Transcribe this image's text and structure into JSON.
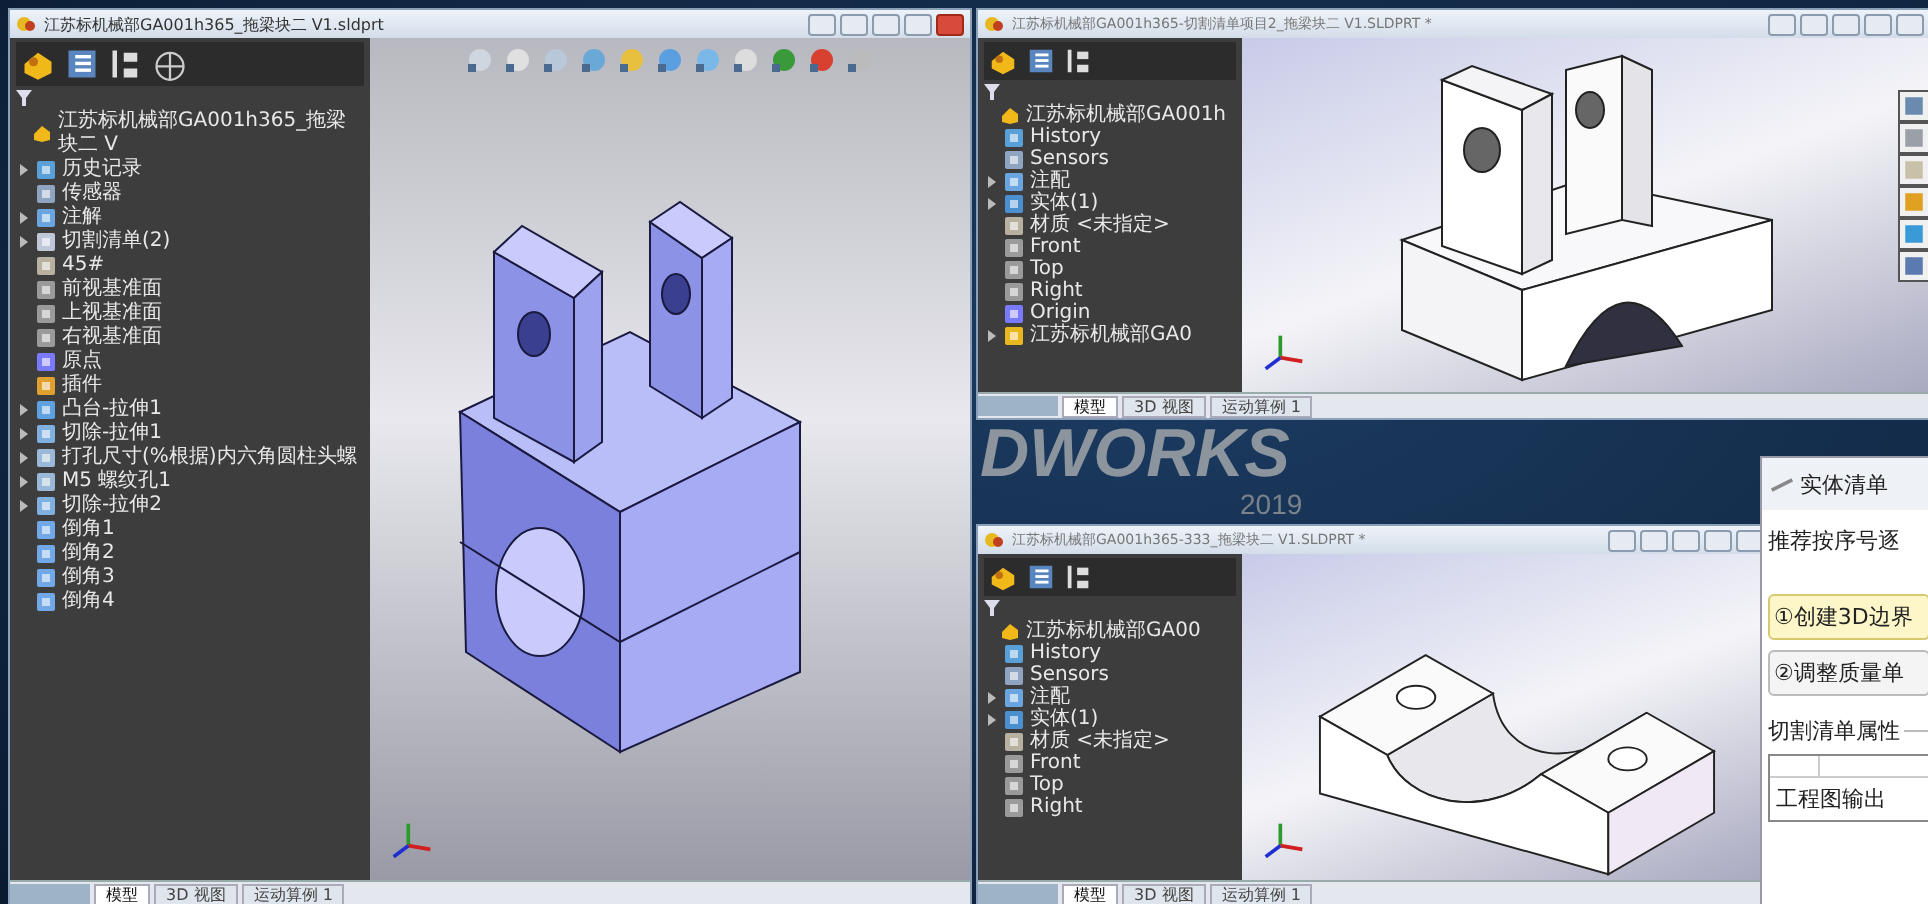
{
  "main_window": {
    "title": "江苏标机械部GA001h365_拖梁块二 V1.sldprt",
    "tree_root": "江苏标机械部GA001h365_拖梁块二 V",
    "tree": [
      {
        "label": "历史记录",
        "kind": "history",
        "expandable": true
      },
      {
        "label": "传感器",
        "kind": "sensor",
        "expandable": false
      },
      {
        "label": "注解",
        "kind": "annotation",
        "expandable": true
      },
      {
        "label": "切割清单(2)",
        "kind": "cutlist",
        "expandable": true
      },
      {
        "label": "45#",
        "kind": "material",
        "expandable": false
      },
      {
        "label": "前视基准面",
        "kind": "plane",
        "expandable": false
      },
      {
        "label": "上视基准面",
        "kind": "plane",
        "expandable": false
      },
      {
        "label": "右视基准面",
        "kind": "plane",
        "expandable": false
      },
      {
        "label": "原点",
        "kind": "origin",
        "expandable": false
      },
      {
        "label": "插件",
        "kind": "plugin",
        "expandable": false
      },
      {
        "label": "凸台-拉伸1",
        "kind": "extrude",
        "expandable": true
      },
      {
        "label": "切除-拉伸1",
        "kind": "cut",
        "expandable": true
      },
      {
        "label": "打孔尺寸(%根据)内六角圆柱头螺",
        "kind": "hole",
        "expandable": true
      },
      {
        "label": "M5 螺纹孔1",
        "kind": "hole",
        "expandable": true
      },
      {
        "label": "切除-拉伸2",
        "kind": "cut",
        "expandable": true
      },
      {
        "label": "倒角1",
        "kind": "chamfer",
        "expandable": false
      },
      {
        "label": "倒角2",
        "kind": "chamfer",
        "expandable": false
      },
      {
        "label": "倒角3",
        "kind": "chamfer",
        "expandable": false
      },
      {
        "label": "倒角4",
        "kind": "chamfer",
        "expandable": false
      }
    ],
    "tabs": [
      {
        "label": "模型",
        "selected": true
      },
      {
        "label": "3D 视图",
        "selected": false
      },
      {
        "label": "运动算例 1",
        "selected": false
      }
    ]
  },
  "top_right_window": {
    "title": "江苏标机械部GA001h365-切割清单项目2_拖梁块二 V1.SLDPRT *",
    "tree_root": "江苏标机械部GA001h",
    "tree": [
      {
        "label": "History",
        "kind": "history",
        "expandable": false
      },
      {
        "label": "Sensors",
        "kind": "sensor",
        "expandable": false
      },
      {
        "label": "注配",
        "kind": "annotation",
        "expandable": true
      },
      {
        "label": "实体(1)",
        "kind": "body",
        "expandable": true
      },
      {
        "label": "材质 <未指定>",
        "kind": "material",
        "expandable": false
      },
      {
        "label": "Front",
        "kind": "plane",
        "expandable": false
      },
      {
        "label": "Top",
        "kind": "plane",
        "expandable": false
      },
      {
        "label": "Right",
        "kind": "plane",
        "expandable": false
      },
      {
        "label": "Origin",
        "kind": "origin",
        "expandable": false
      },
      {
        "label": "江苏标机械部GA0",
        "kind": "part",
        "expandable": true
      }
    ],
    "tabs": [
      {
        "label": "模型",
        "selected": true
      },
      {
        "label": "3D 视图",
        "selected": false
      },
      {
        "label": "运动算例 1",
        "selected": false
      }
    ]
  },
  "splash": {
    "wordmark": "DWORKS",
    "year": "2019"
  },
  "bottom_right_window": {
    "title": "江苏标机械部GA001h365-333_拖梁块二 V1.SLDPRT *",
    "tree_root": "江苏标机械部GA00",
    "tree": [
      {
        "label": "History",
        "kind": "history",
        "expandable": false
      },
      {
        "label": "Sensors",
        "kind": "sensor",
        "expandable": false
      },
      {
        "label": "注配",
        "kind": "annotation",
        "expandable": true
      },
      {
        "label": "实体(1)",
        "kind": "body",
        "expandable": true
      },
      {
        "label": "材质 <未指定>",
        "kind": "material",
        "expandable": false
      },
      {
        "label": "Front",
        "kind": "plane",
        "expandable": false
      },
      {
        "label": "Top",
        "kind": "plane",
        "expandable": false
      },
      {
        "label": "Right",
        "kind": "plane",
        "expandable": false
      }
    ],
    "tabs": [
      {
        "label": "模型",
        "selected": true
      },
      {
        "label": "3D 视图",
        "selected": false
      },
      {
        "label": "运动算例 1",
        "selected": false
      }
    ]
  },
  "dialog": {
    "title": "实体清单",
    "hint": "推荐按序号逐",
    "buttons": [
      {
        "label": "①创建3D边界",
        "highlighted": true
      },
      {
        "label": "②调整质量单",
        "highlighted": false
      }
    ],
    "group_title": "切割清单属性",
    "list_item": "工程图输出"
  }
}
